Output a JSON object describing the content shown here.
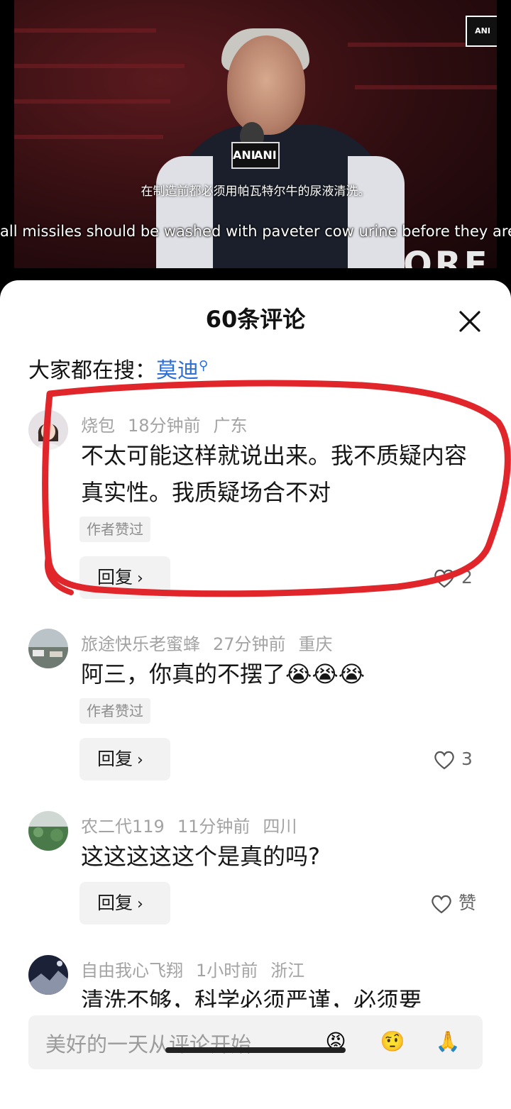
{
  "video": {
    "logo_text": "ANI",
    "mic_label_left": "ANI",
    "mic_label_right": "ANI",
    "subtitle_cn": "在制造前都必须用帕瓦特尔牛的尿液清洗。",
    "subtitle_en": "all missiles should be washed with paveter cow urine before they are m",
    "background_text": "ORE"
  },
  "sheet": {
    "title": "60条评论",
    "close_icon": "close-icon",
    "search_label": "大家都在搜：",
    "search_term": "莫迪",
    "search_icon": "search-icon"
  },
  "comments": [
    {
      "user": "烧包",
      "time": "18分钟前",
      "location": "广东",
      "text": "不太可能这样就说出来。我不质疑内容真实性。我质疑场合不对",
      "badge": "作者赞过",
      "reply_label": "回复",
      "likes": "2"
    },
    {
      "user": "旅途快乐老蜜蜂",
      "time": "27分钟前",
      "location": "重庆",
      "text": "阿三，你真的不摆了",
      "badge": "作者赞过",
      "reply_label": "回复",
      "likes": "3"
    },
    {
      "user": "农二代119",
      "time": "11分钟前",
      "location": "四川",
      "text": "这这这这这个是真的吗?",
      "reply_label": "回复",
      "likes": "赞"
    },
    {
      "user": "自由我心飞翔",
      "time": "1小时前",
      "location": "浙江",
      "text": "清洗不够，科学必须严谨，必须要"
    }
  ],
  "input": {
    "placeholder": "美好的一天从评论开始"
  },
  "colors": {
    "accent_link": "#2c6fd6",
    "annotation_red": "#e0262b"
  }
}
